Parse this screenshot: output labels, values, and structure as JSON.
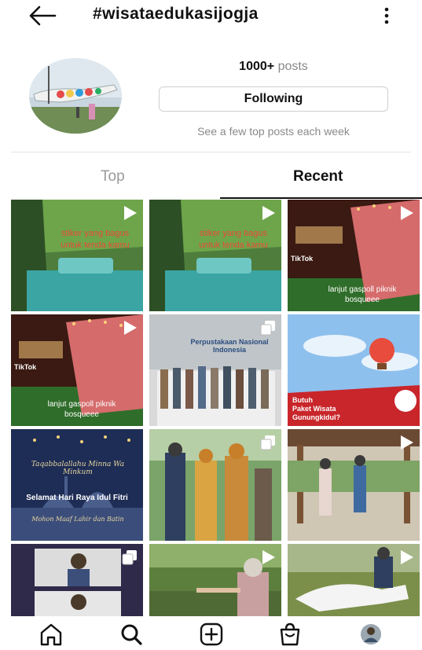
{
  "header": {
    "title": "#wisataedukasijogja"
  },
  "profile": {
    "posts_count": "1000+",
    "posts_label": "posts",
    "follow_button": "Following",
    "hint": "See a few top posts each week"
  },
  "tabs": [
    {
      "label": "Top",
      "active": false
    },
    {
      "label": "Recent",
      "active": true
    }
  ],
  "posts": [
    {
      "type": "video",
      "overlay": [
        "stiker yang bagus",
        "untuk tenda kamu"
      ]
    },
    {
      "type": "video",
      "overlay": [
        "stiker yang bagus",
        "untuk tenda kamu"
      ]
    },
    {
      "type": "video",
      "caption": [
        "lanjut gaspoll piknik",
        "bosqueee"
      ],
      "watermark": "TikTok"
    },
    {
      "type": "video",
      "caption": [
        "lanjut gaspoll piknik",
        "bosqueee"
      ],
      "watermark": "TikTok"
    },
    {
      "type": "carousel",
      "banner": "Perpustakaan Nasional Indonesia"
    },
    {
      "type": "image",
      "headline": [
        "Butuh",
        "Paket Wisata",
        "Gunungkidul?"
      ]
    },
    {
      "type": "image",
      "script": "Taqabbalallahu Minna Wa Minkum",
      "greeting": "Selamat Hari Raya Idul Fitri",
      "subscript": "Mohon Maaf Lahir dan Batin"
    },
    {
      "type": "carousel"
    },
    {
      "type": "video"
    },
    {
      "type": "carousel"
    },
    {
      "type": "video"
    },
    {
      "type": "video"
    }
  ],
  "bottom_nav": [
    {
      "name": "home"
    },
    {
      "name": "search"
    },
    {
      "name": "create"
    },
    {
      "name": "shop"
    },
    {
      "name": "profile"
    }
  ]
}
